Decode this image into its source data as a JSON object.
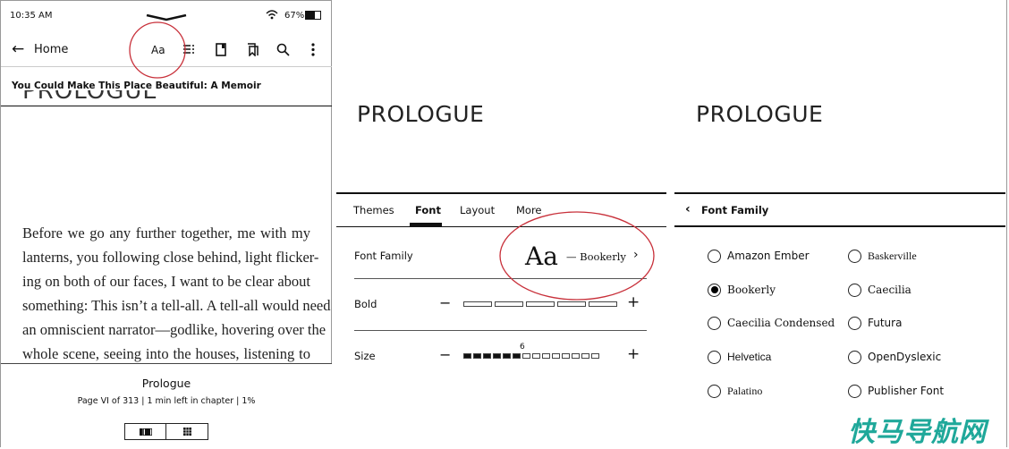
{
  "reader": {
    "status": {
      "time": "10:35 AM",
      "battery": "67%"
    },
    "toolbar": {
      "back_label": "Home",
      "font_button": "Aa"
    },
    "book_title": "You Could Make This Place Beautiful: A Memoir",
    "chapter_heading": "PROLOGUE",
    "body_lines": [
      "Before we go any further together, me with my",
      "lanterns, you following close behind, light flicker-",
      "ing on both of our faces, I want to be clear about",
      "something: This isn’t a tell-all. A tell-all would need",
      "an omniscient narrator—godlike, hovering over the",
      "whole scene, seeing into the houses, listening to"
    ],
    "footer": {
      "chapter": "Prologue",
      "progress": "Page VI of 313 | 1 min left in chapter | 1%"
    }
  },
  "font_panel": {
    "chapter_heading": "PROLOGUE",
    "tabs": [
      {
        "label": "Themes"
      },
      {
        "label": "Font",
        "active": true
      },
      {
        "label": "Layout"
      },
      {
        "label": "More"
      }
    ],
    "font_family": {
      "label": "Font Family",
      "sample": "Aa",
      "value": "— Bookerly"
    },
    "bold": {
      "label": "Bold",
      "level": 0,
      "max": 5
    },
    "size": {
      "label": "Size",
      "value": "6",
      "level": 6,
      "max": 14
    }
  },
  "family_panel": {
    "chapter_heading": "PROLOGUE",
    "title": "Font Family",
    "options": [
      {
        "label": "Amazon Ember",
        "selected": false
      },
      {
        "label": "Baskerville",
        "selected": false
      },
      {
        "label": "Bookerly",
        "selected": true
      },
      {
        "label": "Caecilia",
        "selected": false
      },
      {
        "label": "Caecilia Condensed",
        "selected": false
      },
      {
        "label": "Futura",
        "selected": false
      },
      {
        "label": "Helvetica",
        "selected": false
      },
      {
        "label": "OpenDyslexic",
        "selected": false
      },
      {
        "label": "Palatino",
        "selected": false
      },
      {
        "label": "Publisher Font",
        "selected": false
      }
    ]
  },
  "annotation_color": "#c8303a",
  "watermark": {
    "text": "快马导航网",
    "color": "#1fa89a"
  }
}
